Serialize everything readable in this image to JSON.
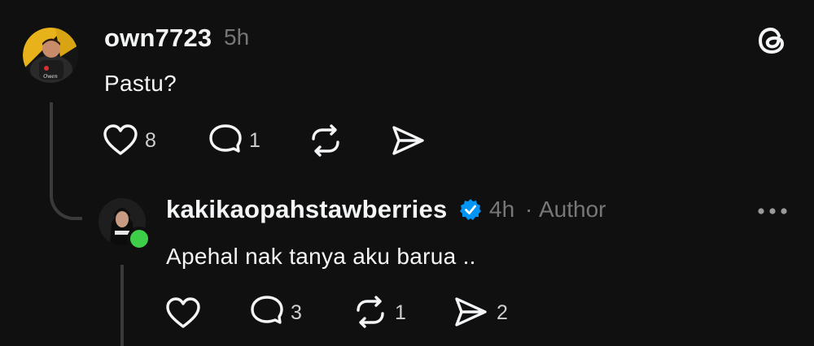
{
  "post": {
    "username": "own7723",
    "time": "5h",
    "text": "Pastu?",
    "likes": "8",
    "replies": "1"
  },
  "reply": {
    "username": "kakikaopahstawberries",
    "time": "4h",
    "separator": "·",
    "role": "Author",
    "text": "Apehal nak tanya aku barua ..",
    "replies": "3",
    "reposts": "1",
    "shares": "2",
    "online_status_color": "#3ecf4a",
    "verified_color": "#0095f6"
  },
  "icons": {
    "app_logo": "threads-logo-icon",
    "like": "heart-icon",
    "reply": "comment-icon",
    "repost": "repost-icon",
    "share": "send-icon",
    "more": "more-horizontal-icon",
    "verified": "verified-badge-icon"
  }
}
